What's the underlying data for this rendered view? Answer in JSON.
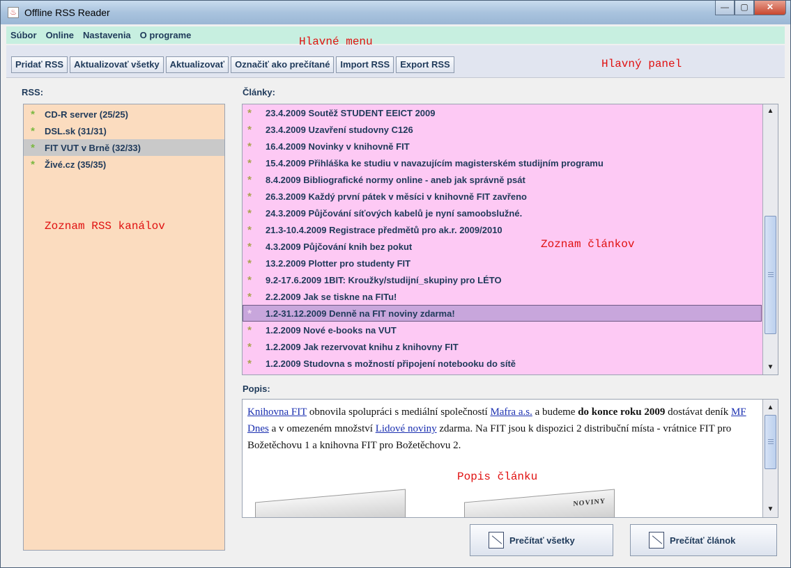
{
  "window": {
    "title": "Offline RSS Reader",
    "minimize": "—",
    "maximize": "▢",
    "close": "✕"
  },
  "menu": {
    "items": [
      "Súbor",
      "Online",
      "Nastavenia",
      "O programe"
    ]
  },
  "notes": {
    "menu": "Hlavné menu",
    "panel": "Hlavný panel",
    "feeds": "Zoznam RSS kanálov",
    "articles": "Zoznam článkov",
    "description": "Popis článku"
  },
  "toolbar": {
    "buttons": [
      "Pridať RSS",
      "Aktualizovať všetky",
      "Aktualizovať",
      "Označiť ako prečítané",
      "Import RSS",
      "Export RSS"
    ]
  },
  "rss": {
    "label": "RSS:",
    "feeds": [
      {
        "name": "CD-R server (25/25)",
        "selected": false
      },
      {
        "name": "DSL.sk (31/31)",
        "selected": false
      },
      {
        "name": "FIT VUT v Brně (32/33)",
        "selected": true
      },
      {
        "name": "Živé.cz (35/35)",
        "selected": false
      }
    ]
  },
  "articles": {
    "label": "Články:",
    "items": [
      {
        "text": "23.4.2009 Soutěž STUDENT EEICT 2009",
        "read": true,
        "selected": false
      },
      {
        "text": "23.4.2009 Uzavření studovny C126",
        "read": true,
        "selected": false
      },
      {
        "text": "16.4.2009 Novinky v knihovně FIT",
        "read": true,
        "selected": false
      },
      {
        "text": "15.4.2009 Přihláška ke studiu v navazujícím magisterském studijním programu",
        "read": true,
        "selected": false
      },
      {
        "text": "8.4.2009 Bibliografické normy online - aneb jak správně psát",
        "read": true,
        "selected": false
      },
      {
        "text": "26.3.2009 Každý první pátek v měsíci v knihovně FIT zavřeno",
        "read": true,
        "selected": false
      },
      {
        "text": "24.3.2009 Půjčování síťových kabelů je nyní samoobslužné.",
        "read": true,
        "selected": false
      },
      {
        "text": "21.3-10.4.2009 Registrace předmětů pro ak.r. 2009/2010",
        "read": true,
        "selected": false
      },
      {
        "text": "4.3.2009 Půjčování knih bez pokut",
        "read": true,
        "selected": false
      },
      {
        "text": "13.2.2009 Plotter pro studenty FIT",
        "read": true,
        "selected": false
      },
      {
        "text": "9.2-17.6.2009 1BIT: Kroužky/studijní_skupiny pro LÉTO",
        "read": true,
        "selected": false
      },
      {
        "text": "2.2.2009 Jak se tiskne na FITu!",
        "read": true,
        "selected": false
      },
      {
        "text": "1.2-31.12.2009 Denně na FIT noviny zdarma!",
        "read": false,
        "selected": true
      },
      {
        "text": "1.2.2009 Nové e-books na VUT",
        "read": true,
        "selected": false
      },
      {
        "text": "1.2.2009 Jak rezervovat knihu z knihovny FIT",
        "read": true,
        "selected": false
      },
      {
        "text": "1.2.2009 Studovna s možností připojení notebooku do sítě",
        "read": true,
        "selected": false
      }
    ]
  },
  "description": {
    "label": "Popis:",
    "link1": "Knihovna FIT",
    "t1": " obnovila spolupráci s mediální společností ",
    "link2": "Mafra a.s.",
    "t2": " a budeme ",
    "bold1": "do konce roku 2009",
    "t3": " dostávat deník ",
    "link3": "MF Dnes",
    "t4": " a v omezeném množství ",
    "link4": "Lidové noviny",
    "t5": " zdarma. Na FIT jsou k dispozici 2 distribuční místa - vrátnice FIT pro Božetěchovu 1 a knihovna FIT pro Božetěchovu 2.",
    "newspaper_mast": "NOVINY"
  },
  "buttons": {
    "read_all": "Prečítať všetky",
    "read_article": "Prečítať článok"
  }
}
